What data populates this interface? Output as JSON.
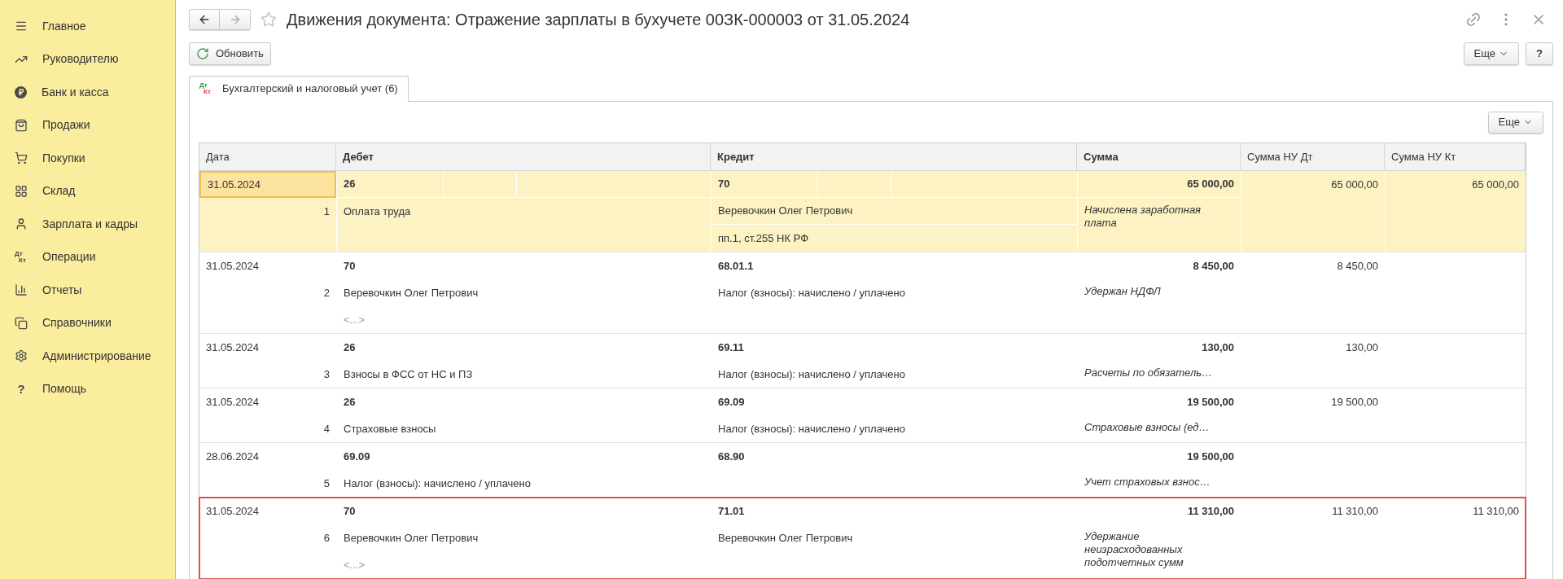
{
  "sidebar": {
    "items": [
      {
        "label": "Главное",
        "kind": "menu"
      },
      {
        "label": "Руководителю",
        "kind": "trend"
      },
      {
        "label": "Банк и касса",
        "kind": "ruble",
        "glyph": "₽"
      },
      {
        "label": "Продажи",
        "kind": "bag"
      },
      {
        "label": "Покупки",
        "kind": "cart"
      },
      {
        "label": "Склад",
        "kind": "grid"
      },
      {
        "label": "Зарплата и кадры",
        "kind": "user"
      },
      {
        "label": "Операции",
        "kind": "dtkt",
        "top": "Дт",
        "bottom": "Кт"
      },
      {
        "label": "Отчеты",
        "kind": "bars"
      },
      {
        "label": "Справочники",
        "kind": "books"
      },
      {
        "label": "Администрирование",
        "kind": "gear"
      },
      {
        "label": "Помощь",
        "kind": "help",
        "glyph": "?"
      }
    ]
  },
  "window": {
    "title": "Движения документа: Отражение зарплаты в бухучете 00ЗК-000003 от 31.05.2024"
  },
  "toolbar": {
    "refresh": "Обновить",
    "more": "Еще",
    "help": "?"
  },
  "tabs": [
    {
      "label": "Бухгалтерский и налоговый учет (6)",
      "top": "Дт",
      "bottom": "Кт",
      "selected": true
    }
  ],
  "panel": {
    "more": "Еще"
  },
  "table": {
    "columns": [
      {
        "label": "Дата",
        "bold": false
      },
      {
        "label": "Дебет",
        "bold": true
      },
      {
        "label": "Кредит",
        "bold": true
      },
      {
        "label": "Сумма",
        "bold": true
      },
      {
        "label": "Сумма НУ Дт",
        "bold": false
      },
      {
        "label": "Сумма НУ Кт",
        "bold": false
      }
    ],
    "rows": [
      {
        "date": "31.05.2024",
        "number": "1",
        "selected": true,
        "outlined": false,
        "debit": {
          "account": "26",
          "lines": [
            "Оплата труда"
          ]
        },
        "credit": {
          "account": "70",
          "lines": [
            "Веревочкин Олег Петрович",
            "пп.1, ст.255 НК РФ"
          ]
        },
        "sum": "65 000,00",
        "content": "Начислена заработная плата",
        "nu_dt": "65 000,00",
        "nu_kt": "65 000,00"
      },
      {
        "date": "31.05.2024",
        "number": "2",
        "selected": false,
        "outlined": false,
        "debit": {
          "account": "70",
          "lines": [
            "Веревочкин Олег Петрович"
          ],
          "more": "<...>"
        },
        "credit": {
          "account": "68.01.1",
          "lines": [
            "Налог (взносы): начислено / уплачено"
          ]
        },
        "sum": "8 450,00",
        "content": "Удержан НДФЛ",
        "nu_dt": "8 450,00"
      },
      {
        "date": "31.05.2024",
        "number": "3",
        "selected": false,
        "outlined": false,
        "debit": {
          "account": "26",
          "lines": [
            "Взносы в ФСС от НС и ПЗ"
          ]
        },
        "credit": {
          "account": "69.11",
          "lines": [
            "Налог (взносы): начислено / уплачено"
          ]
        },
        "sum": "130,00",
        "content": "Расчеты по обязатель…",
        "nu_dt": "130,00"
      },
      {
        "date": "31.05.2024",
        "number": "4",
        "selected": false,
        "outlined": false,
        "debit": {
          "account": "26",
          "lines": [
            "Страховые взносы"
          ]
        },
        "credit": {
          "account": "69.09",
          "lines": [
            "Налог (взносы): начислено / уплачено"
          ]
        },
        "sum": "19 500,00",
        "content": "Страховые взносы (ед…",
        "nu_dt": "19 500,00"
      },
      {
        "date": "28.06.2024",
        "number": "5",
        "selected": false,
        "outlined": false,
        "debit": {
          "account": "69.09",
          "lines": [
            "Налог (взносы): начислено / уплачено"
          ]
        },
        "credit": {
          "account": "68.90"
        },
        "sum": "19 500,00",
        "content": "Учет страховых взнос…"
      },
      {
        "date": "31.05.2024",
        "number": "6",
        "selected": false,
        "outlined": true,
        "debit": {
          "account": "70",
          "lines": [
            "Веревочкин Олег Петрович"
          ],
          "more": "<...>"
        },
        "credit": {
          "account": "71.01",
          "lines": [
            "Веревочкин Олег Петрович"
          ]
        },
        "sum": "11 310,00",
        "content": "Удержание неизрасходованных подотчетных сумм",
        "nu_dt": "11 310,00",
        "nu_kt": "11 310,00"
      }
    ]
  }
}
